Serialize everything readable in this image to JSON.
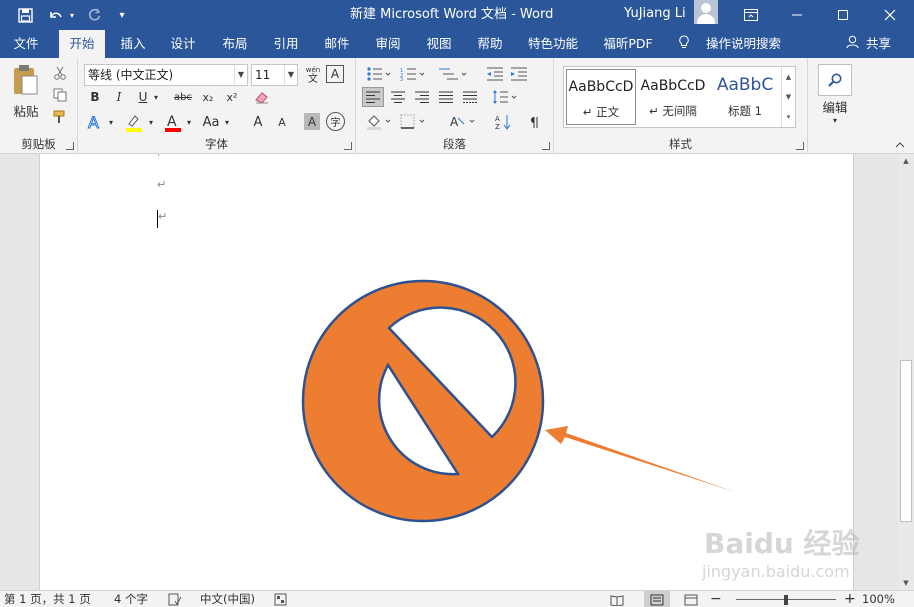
{
  "window": {
    "title": "新建 Microsoft Word 文档  -  Word",
    "user": "YuJiang Li"
  },
  "tabs": [
    "文件",
    "开始",
    "插入",
    "设计",
    "布局",
    "引用",
    "邮件",
    "审阅",
    "视图",
    "帮助",
    "特色功能",
    "福昕PDF"
  ],
  "active_tab": "开始",
  "tell_me": "操作说明搜索",
  "share": "共享",
  "clipboard": {
    "paste_label": "粘贴",
    "group_label": "剪贴板"
  },
  "font": {
    "name": "等线 (中文正文)",
    "size": "11",
    "group_label": "字体",
    "bold": "B",
    "italic": "I",
    "underline": "U",
    "strike": "abc",
    "subscript": "x₂",
    "superscript": "x²",
    "change_case": "Aa",
    "grow": "A",
    "shrink": "A",
    "char_shading": "A",
    "enclose": "字",
    "phonetic_top": "wén",
    "phonetic_bottom": "文",
    "border": "A"
  },
  "paragraph": {
    "group_label": "段落"
  },
  "styles": {
    "group_label": "样式",
    "items": [
      {
        "sample": "AaBbCcD",
        "name": "↵ 正文"
      },
      {
        "sample": "AaBbCcD",
        "name": "↵ 无间隔"
      },
      {
        "sample": "AaBbC",
        "name": "标题 1"
      }
    ]
  },
  "editing": {
    "label": "编辑"
  },
  "document": {
    "paragraph_mark": "↵"
  },
  "status": {
    "page": "第 1 页，共 1 页",
    "words": "4 个字",
    "language": "中文(中国)",
    "zoom": "100%"
  },
  "watermark": {
    "brand": "Baidu 经验",
    "url": "jingyan.baidu.com"
  },
  "colors": {
    "word_blue": "#2b579a",
    "shape_fill": "#ed7d31",
    "shape_stroke": "#2f528f",
    "arrow": "#ed7d31",
    "highlight": "#ffff00",
    "font_color": "#ff0000"
  }
}
